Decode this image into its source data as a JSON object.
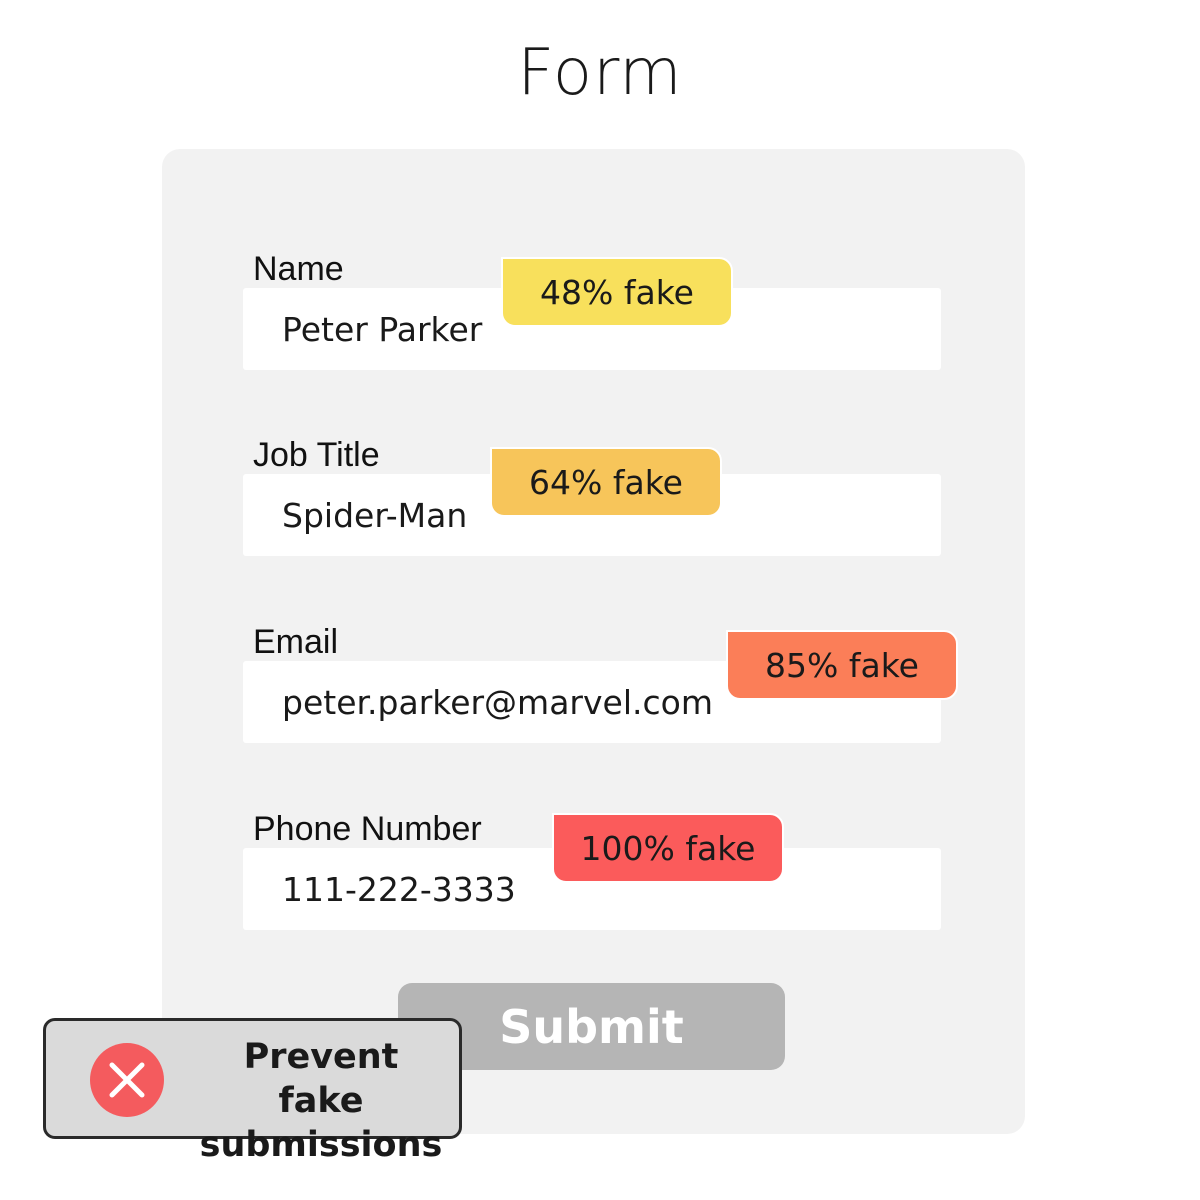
{
  "page": {
    "title": "Form"
  },
  "form": {
    "fields": [
      {
        "label": "Name",
        "value": "Peter Parker",
        "fake_score": "48% fake",
        "badge_color": "#f8e05c"
      },
      {
        "label": "Job Title",
        "value": "Spider-Man",
        "fake_score": "64% fake",
        "badge_color": "#f7c55a"
      },
      {
        "label": "Email",
        "value": "peter.parker@marvel.com",
        "fake_score": "85% fake",
        "badge_color": "#fb7e58"
      },
      {
        "label": "Phone Number",
        "value": "111-222-3333",
        "fake_score": "100% fake",
        "badge_color": "#fb5b5b"
      }
    ],
    "submit_label": "Submit",
    "submit_color": "#b5b5b5"
  },
  "toast": {
    "icon": "close-circle-icon",
    "icon_color": "#f45b5e",
    "line1": "Prevent fake",
    "line2": "submissions"
  }
}
